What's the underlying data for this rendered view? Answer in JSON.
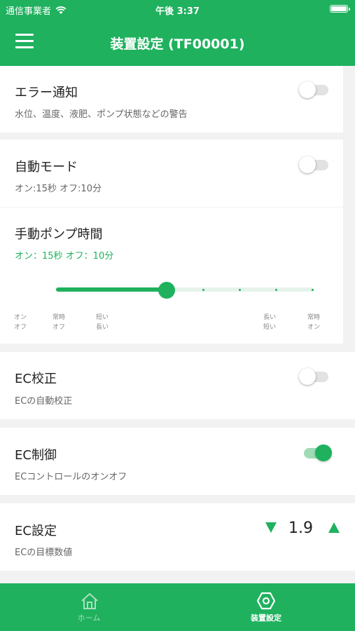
{
  "status_bar": {
    "carrier": "通信事業者",
    "time": "午後 3:37"
  },
  "header": {
    "title": "装置設定 (TF00001)"
  },
  "settings": {
    "error_notify": {
      "title": "エラー通知",
      "subtitle": "水位、温度、液肥、ポンプ状態などの警告",
      "enabled": false
    },
    "auto_mode": {
      "title": "自動モード",
      "subtitle": "オン:15秒 オフ:10分",
      "enabled": false
    },
    "manual_pump": {
      "title": "手動ポンプ時間",
      "subtitle": "オン：15秒 オフ：10分",
      "slider_value": 0.42,
      "labels": [
        {
          "top": "オン",
          "bottom": "オフ"
        },
        {
          "top": "常時",
          "bottom": "オフ"
        },
        {
          "top": "短い",
          "bottom": "長い"
        },
        {
          "top": "長い",
          "bottom": "短い"
        },
        {
          "top": "常時",
          "bottom": "オン"
        }
      ]
    },
    "ec_calibration": {
      "title": "EC校正",
      "subtitle": "ECの自動校正",
      "enabled": false
    },
    "ec_control": {
      "title": "EC制御",
      "subtitle": "ECコントロールのオンオフ",
      "enabled": true
    },
    "ec_setting": {
      "title": "EC設定",
      "subtitle": "ECの目標数値",
      "value": "1.9"
    }
  },
  "tab_bar": {
    "tabs": [
      {
        "label": "ホーム",
        "icon": "home-icon",
        "active": false
      },
      {
        "label": "装置設定",
        "icon": "hex-nut-icon",
        "active": true
      }
    ]
  },
  "colors": {
    "accent": "#1fb15e",
    "accent_light": "#9fdcb6",
    "background": "#f2f2f2"
  }
}
